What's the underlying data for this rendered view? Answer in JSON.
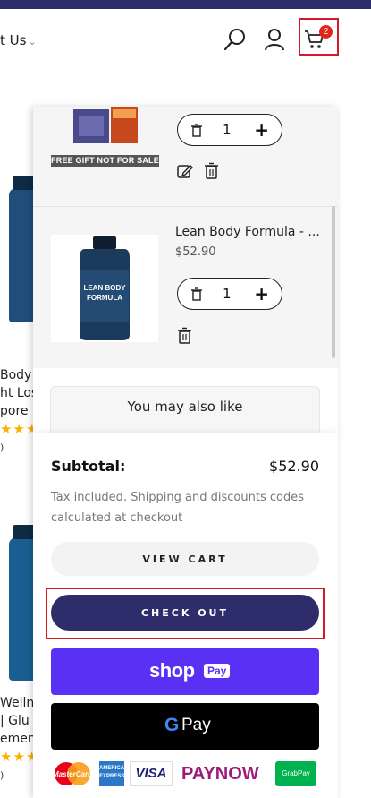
{
  "header": {
    "nav_partial": "t Us",
    "cart_count": "2",
    "icons": [
      "search-icon",
      "account-icon",
      "cart-icon"
    ]
  },
  "background_products": [
    {
      "title_lines": [
        "Body F",
        "ht Los",
        "pore"
      ],
      "rating_count": ")"
    },
    {
      "title_lines": [
        "Wellne",
        "| Glu",
        "emen"
      ],
      "rating_count": ")"
    }
  ],
  "cart": {
    "items": [
      {
        "badge": "FREE GIFT NOT FOR SALE",
        "quantity": "1"
      },
      {
        "title": "Lean Body Formula - ...",
        "price": "$52.90",
        "quantity": "1",
        "image_text": "LEAN BODY FORMULA"
      }
    ],
    "upsell_title": "You may also like",
    "subtotal_label": "Subtotal:",
    "subtotal_value": "$52.90",
    "tax_note": "Tax included. Shipping and discounts codes calculated at checkout",
    "view_cart_label": "VIEW CART",
    "checkout_label": "CHECK OUT",
    "shop_pay_wordmark": "shop",
    "shop_pay_badge": "Pay",
    "gpay_g": "G",
    "gpay_label": "Pay",
    "payment_methods": [
      "MasterCard",
      "AMERICAN EXPRESS",
      "VISA",
      "PAYNOW",
      "GrabPay"
    ]
  },
  "colors": {
    "brand_navy": "#2e2d6b",
    "highlight_red": "#d2192b",
    "shop_pay_purple": "#5a31f4",
    "star_gold": "#f5b301"
  }
}
